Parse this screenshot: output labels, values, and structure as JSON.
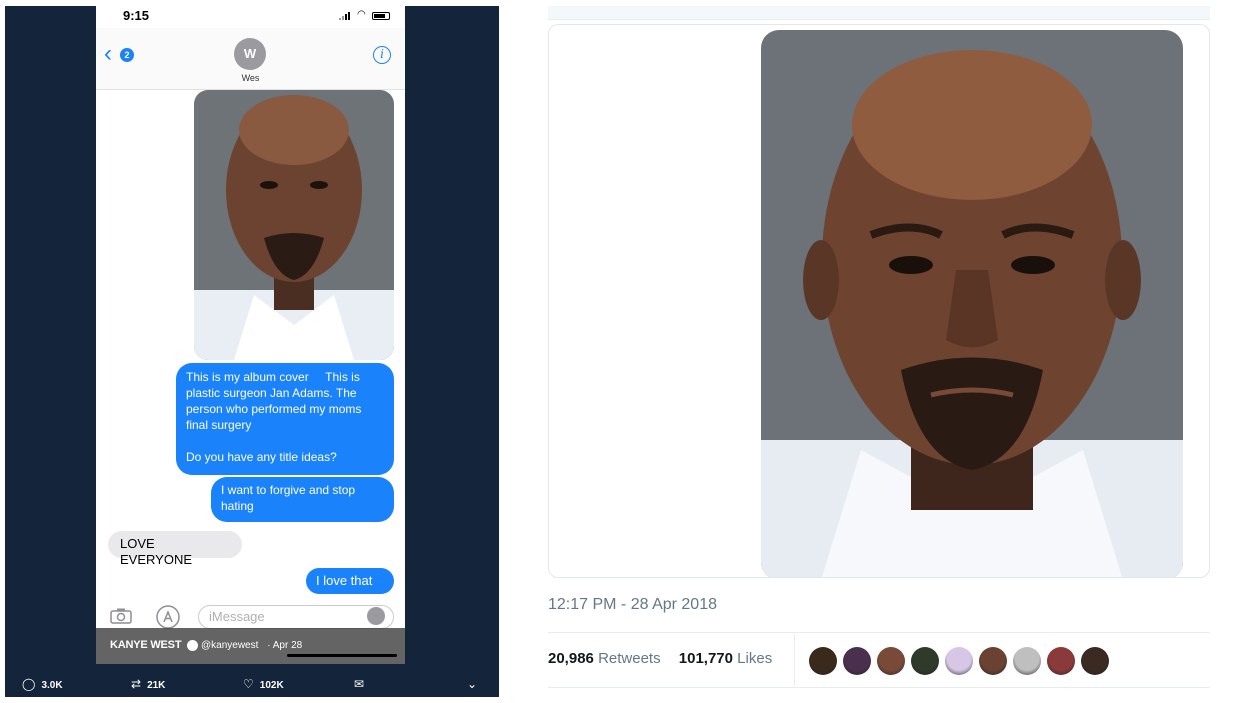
{
  "phone": {
    "status_time": "9:15",
    "back_count": "2",
    "contact_initial": "W",
    "contact_name": "Wes",
    "messages": [
      {
        "direction": "out",
        "text": "This is my album cover     This is plastic surgeon Jan Adams. The person who performed my moms final surgery\n\nDo you have any title ideas?"
      },
      {
        "direction": "out",
        "text": "I want to forgive and stop hating"
      },
      {
        "direction": "in",
        "text": "LOVE EVERYONE"
      },
      {
        "direction": "out",
        "text": "I love that"
      }
    ],
    "input_placeholder": "iMessage"
  },
  "tweet_card": {
    "author_name": "KANYE WEST",
    "author_handle": "@kanyewest",
    "date": "· Apr 28",
    "replies": "3.0K",
    "retweets": "21K",
    "likes": "102K"
  },
  "tweet_detail": {
    "timestamp": "12:17 PM - 28 Apr 2018",
    "retweet_count": "20,986",
    "retweet_label": "Retweets",
    "like_count": "101,770",
    "like_label": "Likes",
    "liker_avatar_colors": [
      "#3a2a1c",
      "#4b2f4e",
      "#7a4a38",
      "#2f3a2a",
      "#d7c6e6",
      "#6b4232",
      "#bfbfbf",
      "#8a3a3a",
      "#3b2a22"
    ]
  },
  "colors": {
    "imessage_blue": "#1a82fb",
    "imessage_gray": "#e9e9eb",
    "card_navy": "#14243a",
    "twitter_gray": "#657786"
  }
}
